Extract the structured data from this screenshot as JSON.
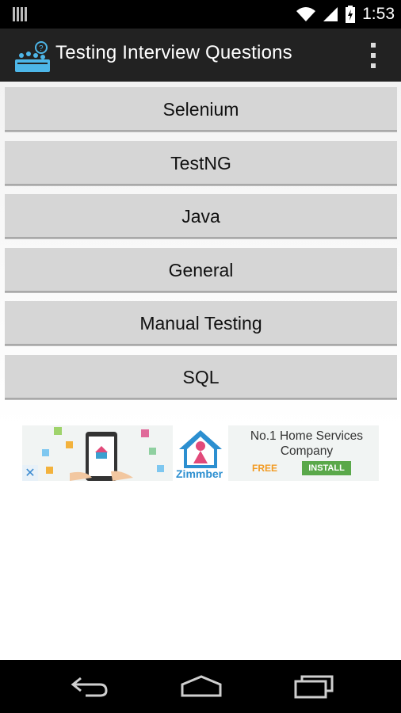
{
  "status_bar": {
    "time": "1:53"
  },
  "app_bar": {
    "title": "Testing Interview Questions"
  },
  "menu": [
    {
      "label": "Selenium"
    },
    {
      "label": "TestNG"
    },
    {
      "label": "Java"
    },
    {
      "label": "General"
    },
    {
      "label": "Manual Testing"
    },
    {
      "label": "SQL"
    }
  ],
  "ad": {
    "brand": "Zimmber",
    "headline": "No.1 Home Services Company",
    "free_label": "FREE",
    "install_label": "INSTALL"
  },
  "colors": {
    "status_bar_bg": "#000000",
    "action_bar_bg": "#222222",
    "button_bg": "#d6d6d6",
    "ad_install_bg": "#5aa84a",
    "ad_free_text": "#f29a22"
  },
  "icons": [
    "notification-icon",
    "wifi-icon",
    "signal-icon",
    "battery-icon",
    "app-logo-icon",
    "overflow-menu-icon",
    "back-icon",
    "home-icon",
    "recents-icon",
    "ad-close-icon"
  ]
}
